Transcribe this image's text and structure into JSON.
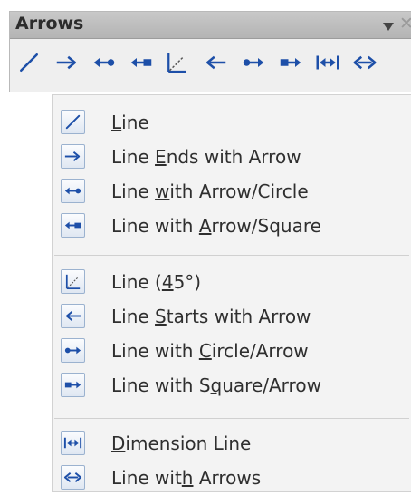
{
  "toolbar": {
    "title": "Arrows",
    "menu_glyph": "▼",
    "close_glyph": "✕",
    "buttons": [
      {
        "icon": "line-icon"
      },
      {
        "icon": "line-ends-with-arrow-icon"
      },
      {
        "icon": "line-arrow-circle-icon"
      },
      {
        "icon": "line-arrow-square-icon"
      },
      {
        "icon": "line-45-icon"
      },
      {
        "icon": "line-starts-with-arrow-icon"
      },
      {
        "icon": "line-circle-arrow-icon"
      },
      {
        "icon": "line-square-arrow-icon"
      },
      {
        "icon": "dimension-line-icon"
      },
      {
        "icon": "line-with-arrows-icon"
      }
    ]
  },
  "menu": {
    "items": [
      {
        "pre": "",
        "key": "L",
        "post": "ine",
        "icon": "line-icon"
      },
      {
        "pre": "Line ",
        "key": "E",
        "post": "nds with Arrow",
        "icon": "line-ends-with-arrow-icon"
      },
      {
        "pre": "Line ",
        "key": "w",
        "post": "ith Arrow/Circle",
        "icon": "line-arrow-circle-icon"
      },
      {
        "pre": "Line with ",
        "key": "A",
        "post": "rrow/Square",
        "icon": "line-arrow-square-icon"
      },
      {
        "pre": "Line (",
        "key": "4",
        "post": "5°)",
        "icon": "line-45-icon"
      },
      {
        "pre": "Line ",
        "key": "S",
        "post": "tarts with Arrow",
        "icon": "line-starts-with-arrow-icon"
      },
      {
        "pre": "Line with ",
        "key": "C",
        "post": "ircle/Arrow",
        "icon": "line-circle-arrow-icon"
      },
      {
        "pre": "Line with S",
        "key": "q",
        "post": "uare/Arrow",
        "icon": "line-square-arrow-icon"
      },
      {
        "pre": "",
        "key": "D",
        "post": "imension Line",
        "icon": "dimension-line-icon"
      },
      {
        "pre": "Line wit",
        "key": "h",
        "post": " Arrows",
        "icon": "line-with-arrows-icon"
      }
    ]
  },
  "colors": {
    "icon_blue": "#1d4fa8",
    "diag_gray": "#555555"
  }
}
